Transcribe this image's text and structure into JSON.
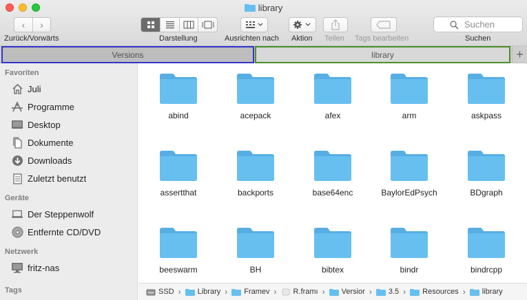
{
  "window": {
    "title": "library"
  },
  "toolbar": {
    "back_forward_label": "Zurück/Vorwärts",
    "view_label": "Darstellung",
    "arrange_label": "Ausrichten nach",
    "action_label": "Aktion",
    "share_label": "Teilen",
    "tags_label": "Tags bearbeiten",
    "search_label": "Suchen",
    "search_placeholder": "Suchen"
  },
  "tabs": [
    {
      "label": "Versions"
    },
    {
      "label": "library"
    }
  ],
  "sidebar": {
    "sections": [
      {
        "title": "Favoriten",
        "items": [
          {
            "label": "Juli",
            "icon": "home-icon"
          },
          {
            "label": "Programme",
            "icon": "applications-icon"
          },
          {
            "label": "Desktop",
            "icon": "desktop-icon"
          },
          {
            "label": "Dokumente",
            "icon": "documents-icon"
          },
          {
            "label": "Downloads",
            "icon": "downloads-icon"
          },
          {
            "label": "Zuletzt benutzt",
            "icon": "recents-icon"
          }
        ]
      },
      {
        "title": "Geräte",
        "items": [
          {
            "label": "Der Steppenwolf",
            "icon": "laptop-icon"
          },
          {
            "label": "Entfernte CD/DVD",
            "icon": "disc-icon"
          }
        ]
      },
      {
        "title": "Netzwerk",
        "items": [
          {
            "label": "fritz-nas",
            "icon": "monitor-icon"
          }
        ]
      },
      {
        "title": "Tags",
        "items": []
      }
    ]
  },
  "folders": [
    "abind",
    "acepack",
    "afex",
    "arm",
    "askpass",
    "assertthat",
    "backports",
    "base64enc",
    "BaylorEdPsych",
    "BDgraph",
    "beeswarm",
    "BH",
    "bibtex",
    "bindr",
    "bindrcpp"
  ],
  "pathbar": [
    {
      "label": "SSD",
      "icon": "drive-icon"
    },
    {
      "label": "Library",
      "icon": "folder-icon"
    },
    {
      "label": "Framev",
      "icon": "folder-icon"
    },
    {
      "label": "R.framı",
      "icon": "framework-icon"
    },
    {
      "label": "Versior",
      "icon": "folder-icon"
    },
    {
      "label": "3.5",
      "icon": "folder-icon"
    },
    {
      "label": "Resources",
      "icon": "folder-icon"
    },
    {
      "label": "library",
      "icon": "folder-icon"
    }
  ],
  "colors": {
    "folder": "#67bff0",
    "folder_tab": "#56aee3",
    "tab_versions_border": "#3333cc",
    "tab_library_border": "#4b8f29"
  }
}
